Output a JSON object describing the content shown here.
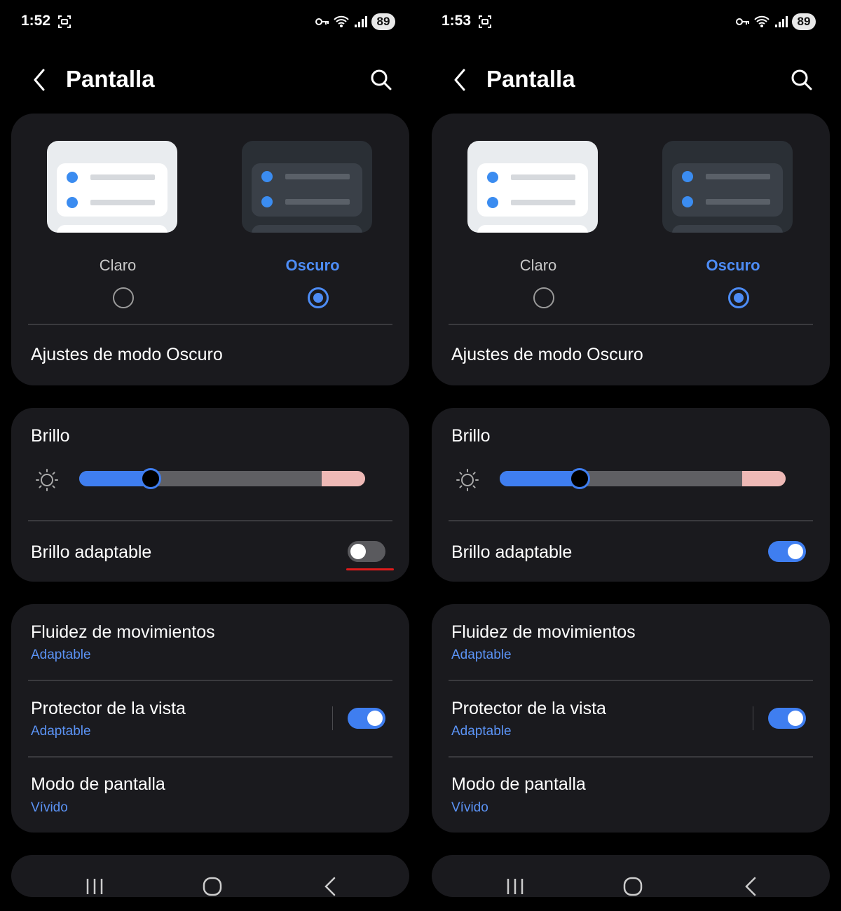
{
  "screens": [
    {
      "status": {
        "time": "1:52",
        "battery": "89"
      },
      "header": {
        "title": "Pantalla"
      },
      "theme": {
        "light_label": "Claro",
        "dark_label": "Oscuro",
        "selected": "dark",
        "settings_label": "Ajustes de modo Oscuro"
      },
      "brightness": {
        "title": "Brillo",
        "level": 0.25,
        "adaptive_label": "Brillo adaptable",
        "adaptive_on": false
      },
      "motion": {
        "title": "Fluidez de movimientos",
        "value": "Adaptable"
      },
      "eye_comfort": {
        "title": "Protector de la vista",
        "value": "Adaptable",
        "on": true
      },
      "screen_mode": {
        "title": "Modo de pantalla",
        "value": "Vívido"
      }
    },
    {
      "status": {
        "time": "1:53",
        "battery": "89"
      },
      "header": {
        "title": "Pantalla"
      },
      "theme": {
        "light_label": "Claro",
        "dark_label": "Oscuro",
        "selected": "dark",
        "settings_label": "Ajustes de modo Oscuro"
      },
      "brightness": {
        "title": "Brillo",
        "level": 0.28,
        "adaptive_label": "Brillo adaptable",
        "adaptive_on": true
      },
      "motion": {
        "title": "Fluidez de movimientos",
        "value": "Adaptable"
      },
      "eye_comfort": {
        "title": "Protector de la vista",
        "value": "Adaptable",
        "on": true
      },
      "screen_mode": {
        "title": "Modo de pantalla",
        "value": "Vívido"
      }
    }
  ],
  "colors": {
    "accent": "#3f7ef0",
    "card": "#1a1a1e",
    "link": "#5b93f5"
  }
}
